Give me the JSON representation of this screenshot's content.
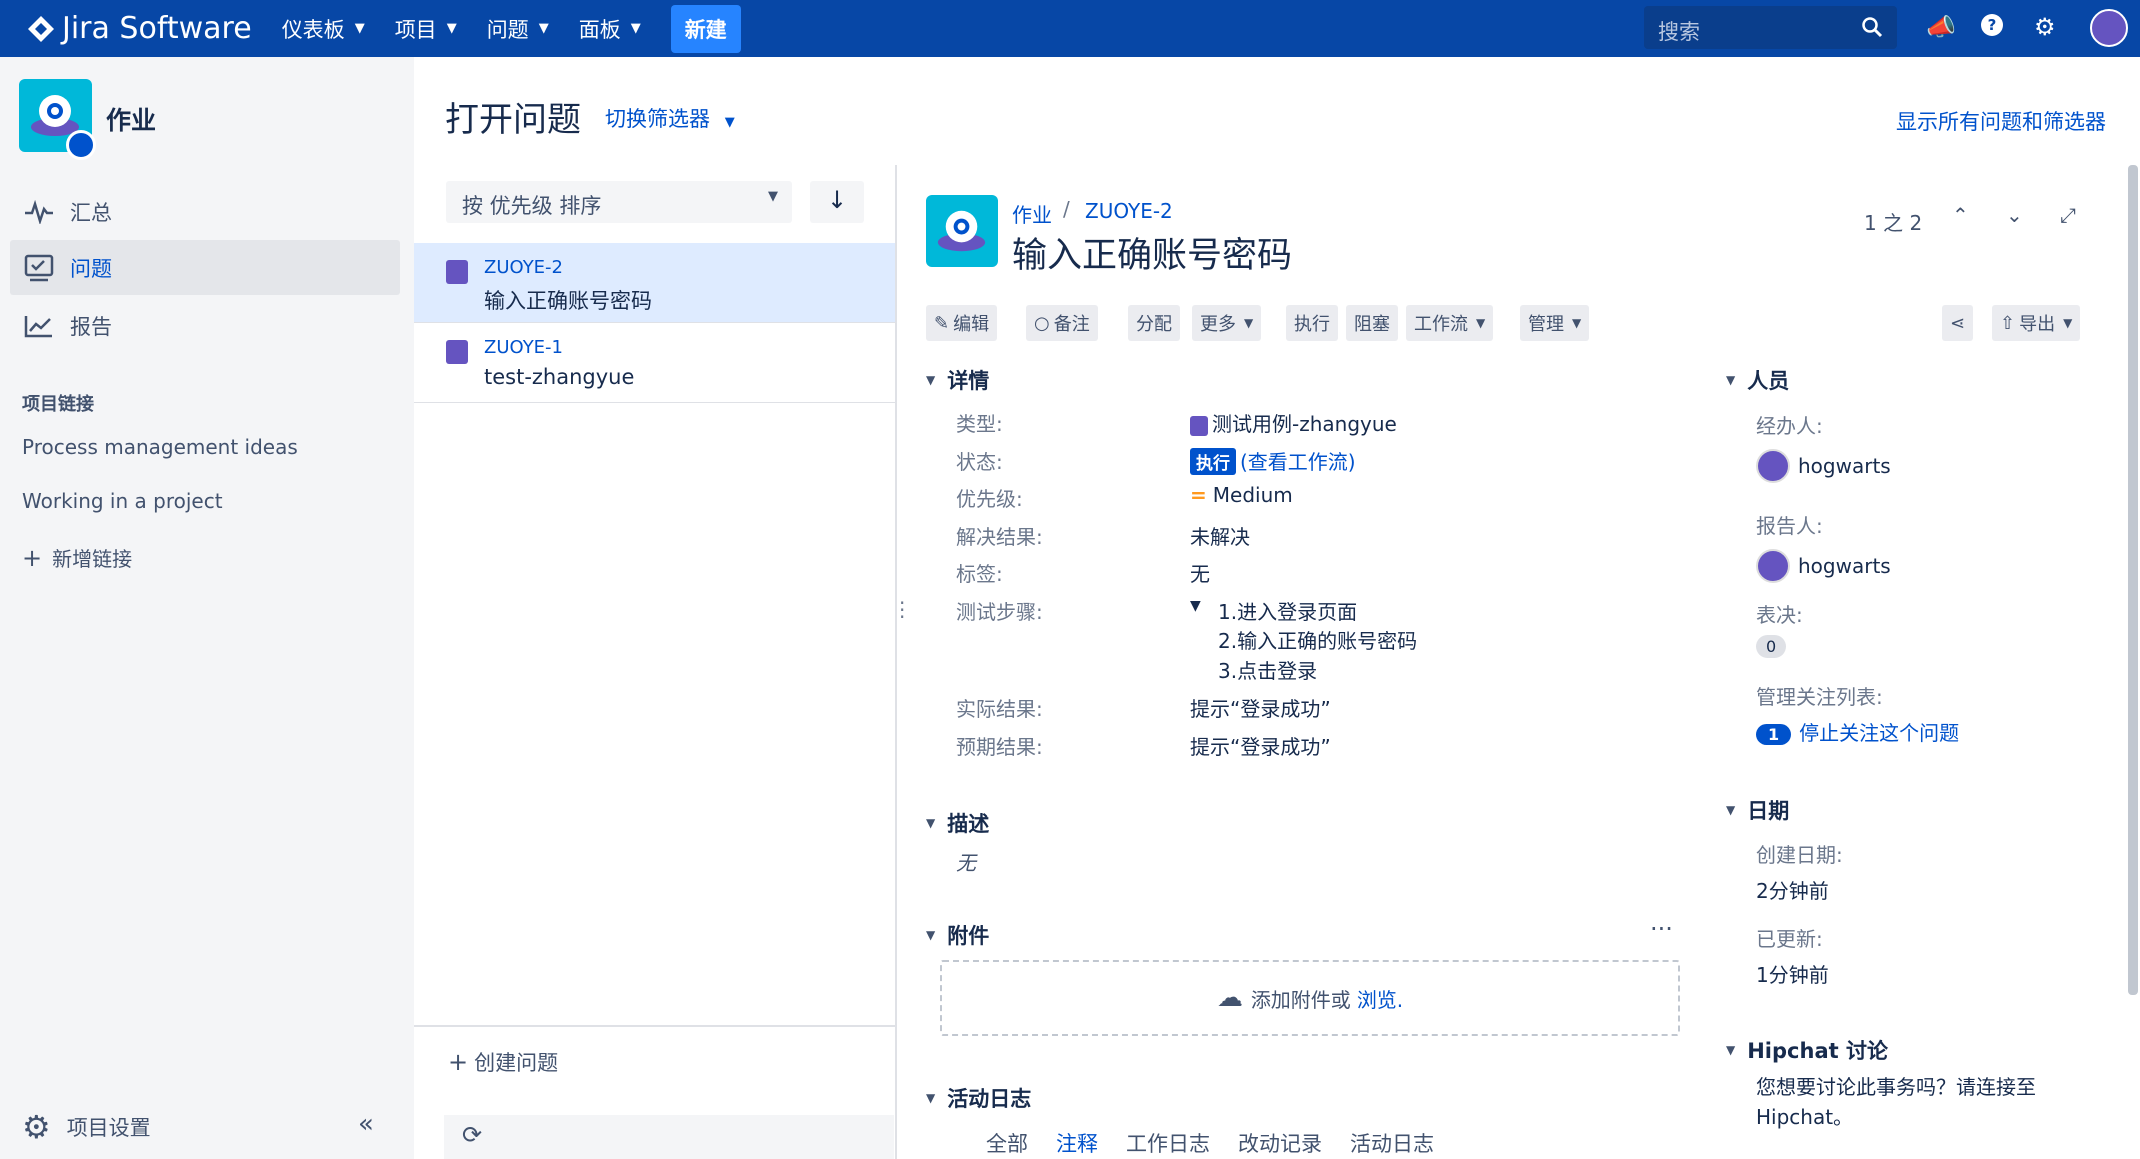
{
  "topbar": {
    "logo": "Jira Software",
    "nav": [
      {
        "label": "仪表板"
      },
      {
        "label": "项目"
      },
      {
        "label": "问题"
      },
      {
        "label": "面板"
      }
    ],
    "create": "新建",
    "search_placeholder": "搜索"
  },
  "sidebar": {
    "project_name": "作业",
    "items": [
      {
        "label": "汇总"
      },
      {
        "label": "问题"
      },
      {
        "label": "报告"
      }
    ],
    "links_heading": "项目链接",
    "links": [
      "Process management ideas",
      "Working in a project"
    ],
    "add_link": "新增链接",
    "settings": "项目设置"
  },
  "main": {
    "title": "打开问题",
    "switch_filter": "切换筛选器",
    "show_all": "显示所有问题和筛选器"
  },
  "list": {
    "sort_label": "按 优先级 排序",
    "issues": [
      {
        "key": "ZUOYE-2",
        "summary": "输入正确账号密码"
      },
      {
        "key": "ZUOYE-1",
        "summary": "test-zhangyue"
      }
    ],
    "create_issue": "创建问题"
  },
  "detail": {
    "breadcrumb": {
      "project": "作业",
      "key": "ZUOYE-2"
    },
    "title": "输入正确账号密码",
    "pager": "1 之 2",
    "toolbar": {
      "edit": "编辑",
      "comment": "备注",
      "assign": "分配",
      "more": "更多",
      "execute": "执行",
      "block": "阻塞",
      "workflow": "工作流",
      "admin": "管理",
      "export": "导出"
    },
    "details_heading": "详情",
    "fields": {
      "type_label": "类型:",
      "type_value": "测试用例-zhangyue",
      "status_label": "状态:",
      "status_value": "执行",
      "status_link": "(查看工作流)",
      "priority_label": "优先级:",
      "priority_value": "Medium",
      "resolution_label": "解决结果:",
      "resolution_value": "未解决",
      "labels_label": "标签:",
      "labels_value": "无",
      "steps_label": "测试步骤:",
      "steps": [
        "1.进入登录页面",
        "2.输入正确的账号密码",
        "3.点击登录"
      ],
      "actual_label": "实际结果:",
      "actual_value": "提示“登录成功”",
      "expected_label": "预期结果:",
      "expected_value": "提示“登录成功”"
    },
    "description_heading": "描述",
    "description_value": "无",
    "attachments_heading": "附件",
    "attach_text": "添加附件或",
    "attach_browse": "浏览.",
    "activity_heading": "活动日志",
    "activity_tabs": [
      "全部",
      "注释",
      "工作日志",
      "改动记录",
      "活动日志"
    ],
    "people_heading": "人员",
    "assignee_label": "经办人:",
    "assignee": "hogwarts",
    "reporter_label": "报告人:",
    "reporter": "hogwarts",
    "votes_label": "表决:",
    "votes": "0",
    "watchers_label": "管理关注列表:",
    "watchers_count": "1",
    "watchers_action": "停止关注这个问题",
    "dates_heading": "日期",
    "created_label": "创建日期:",
    "created": "2分钟前",
    "updated_label": "已更新:",
    "updated": "1分钟前",
    "hipchat_heading": "Hipchat 讨论",
    "hipchat_text": "您想要讨论此事务吗？请连接至 Hipchat。"
  }
}
